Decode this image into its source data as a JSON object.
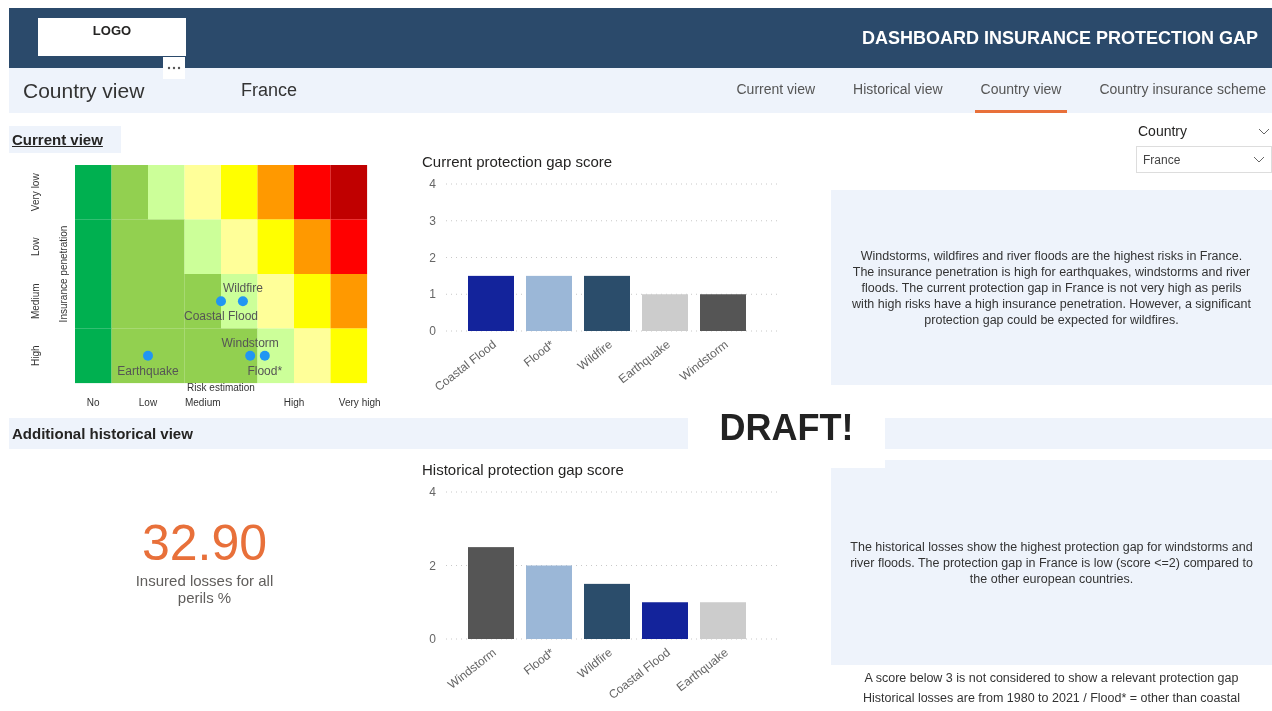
{
  "header": {
    "logo": "LOGO",
    "title": "DASHBOARD INSURANCE PROTECTION GAP"
  },
  "nav": {
    "page_title": "Country view",
    "country": "France",
    "tabs": [
      {
        "label": "Current view",
        "selected": false
      },
      {
        "label": "Historical view",
        "selected": false
      },
      {
        "label": "Country view",
        "selected": true
      },
      {
        "label": "Country insurance scheme",
        "selected": false
      }
    ]
  },
  "current_view": {
    "heading": "Current view",
    "risk_matrix": {
      "xlabel": "Risk estimation",
      "ylabel": "Insurance penetration",
      "x_labels": [
        "No",
        "Low",
        "Medium",
        "High",
        "Very high"
      ],
      "y_labels": [
        "Very low",
        "Low",
        "Medium",
        "High"
      ],
      "markers": [
        "Wildfire",
        "Coastal Flood",
        "Windstorm",
        "Earthquake",
        "Flood*"
      ]
    },
    "chart_data": {
      "type": "bar",
      "title": "Current protection gap score",
      "categories": [
        "Coastal Flood",
        "Flood*",
        "Wildfire",
        "Earthquake",
        "Windstorm"
      ],
      "ylim": [
        0,
        4
      ],
      "grid": true,
      "yticks": [
        0,
        1,
        2,
        3,
        4
      ],
      "series": [
        {
          "colors": [
            "#13239b",
            "#9bb7d7",
            "#2b4d6b",
            "#cccccc",
            "#555555"
          ],
          "values": [
            1.5,
            1.5,
            1.5,
            1,
            1
          ]
        }
      ]
    },
    "filter": {
      "label": "Country",
      "value": "France"
    },
    "summary": "Windstorms, wildfires and river floods are the highest risks in France. The insurance penetration is high for earthquakes, windstorms and river floods. The current protection gap in France is not very high as perils with high risks have a high insurance penetration. However, a significant protection gap could be expected for wildfires."
  },
  "draft_label": "DRAFT!",
  "historical_view": {
    "heading": "Additional historical view",
    "kpi": {
      "value": "32.90",
      "label": "Insured losses for all perils %"
    },
    "chart_data": {
      "type": "bar",
      "title": "Historical protection gap score",
      "categories": [
        "Windstorm",
        "Flood*",
        "Wildfire",
        "Coastal Flood",
        "Earthquake"
      ],
      "ylim": [
        0,
        4
      ],
      "grid": true,
      "yticks": [
        0,
        2,
        4
      ],
      "series": [
        {
          "colors": [
            "#555555",
            "#9bb7d7",
            "#2b4d6b",
            "#13239b",
            "#cccccc"
          ],
          "values": [
            2.5,
            2,
            1.5,
            1,
            1
          ]
        }
      ]
    },
    "summary": "The historical losses show the highest protection gap for windstorms and river floods. The protection gap in France is low (score <=2) compared to the other european countries.",
    "notes": [
      "A score below 3 is not considered to show a relevant protection gap",
      "Historical losses are from 1980 to 2021 / Flood* = other than coastal"
    ]
  }
}
